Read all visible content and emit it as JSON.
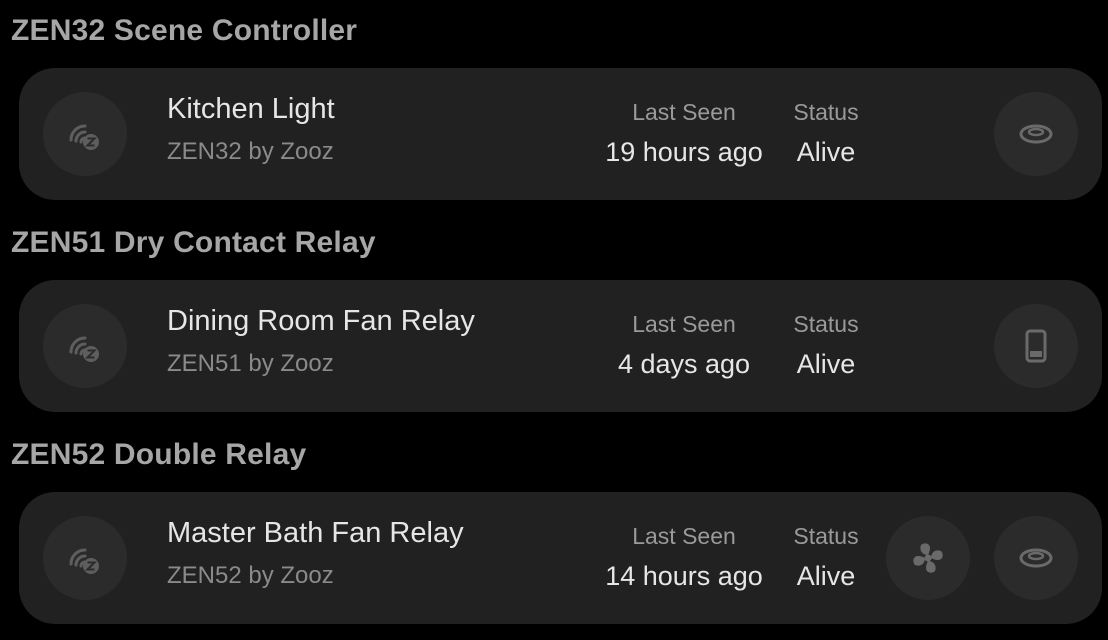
{
  "groups": [
    {
      "title": "ZEN32 Scene Controller",
      "device": {
        "name": "Kitchen Light",
        "model": "ZEN32 by Zooz",
        "last_seen_label": "Last Seen",
        "last_seen": "19 hours ago",
        "status_label": "Status",
        "status": "Alive",
        "actions": [
          "light-icon"
        ]
      }
    },
    {
      "title": "ZEN51 Dry Contact Relay",
      "device": {
        "name": "Dining Room Fan Relay",
        "model": "ZEN51 by Zooz",
        "last_seen_label": "Last Seen",
        "last_seen": "4 days ago",
        "status_label": "Status",
        "status": "Alive",
        "actions": [
          "tablet-icon"
        ]
      }
    },
    {
      "title": "ZEN52 Double Relay",
      "device": {
        "name": "Master Bath Fan Relay",
        "model": "ZEN52 by Zooz",
        "last_seen_label": "Last Seen",
        "last_seen": "14 hours ago",
        "status_label": "Status",
        "status": "Alive",
        "actions": [
          "fan-icon",
          "light-icon"
        ]
      }
    }
  ],
  "icons": {
    "device": "zwave-icon"
  }
}
